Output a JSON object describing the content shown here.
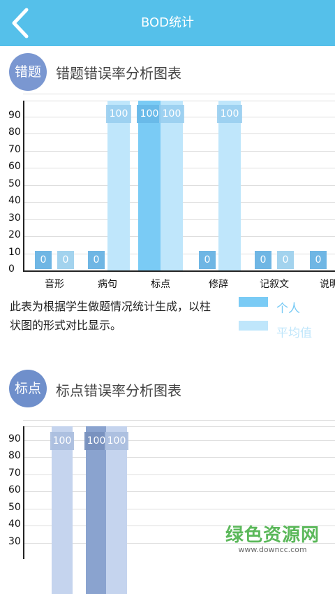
{
  "header": {
    "title": "BOD统计"
  },
  "section1": {
    "badge": "错题",
    "title": "错题错误率分析图表",
    "chart_data": {
      "type": "bar",
      "categories": [
        "音形",
        "病句",
        "标点",
        "修辞",
        "记叙文",
        "说明"
      ],
      "series": [
        {
          "name": "个人",
          "values": [
            0,
            0,
            100,
            0,
            0,
            0
          ]
        },
        {
          "name": "平均值",
          "values": [
            0,
            100,
            100,
            100,
            0,
            null
          ]
        }
      ],
      "yticks": [
        "0",
        "10",
        "20",
        "30",
        "40",
        "50",
        "60",
        "70",
        "80",
        "90"
      ],
      "ylim": [
        0,
        100
      ]
    },
    "description": "此表为根据学生做题情况统计生成，以柱状图的形式对比显示。",
    "legend": [
      {
        "label": "个人",
        "color": "#7acbf5"
      },
      {
        "label": "平均值",
        "color": "#bfe6fb"
      }
    ]
  },
  "section2": {
    "badge": "标点",
    "title": "标点错误率分析图表",
    "chart_data": {
      "type": "bar",
      "categories": [],
      "series": [
        {
          "name": "个人",
          "values": [
            null,
            100
          ]
        },
        {
          "name": "平均值",
          "values": [
            100,
            100
          ]
        }
      ],
      "yticks": [
        "30",
        "40",
        "50",
        "60",
        "70",
        "80",
        "90"
      ],
      "ylim": [
        0,
        100
      ]
    }
  },
  "colors": {
    "header": "#55c0ea",
    "badge1": "#7a97d1",
    "badge2": "#6f8fcb",
    "personal1": "#7acbf5",
    "average1": "#bfe6fb",
    "personal2": "#8aa3cf",
    "average2": "#c5d4ee"
  },
  "watermark": {
    "cn": "绿色资源网",
    "url": "www.downcc.com"
  }
}
